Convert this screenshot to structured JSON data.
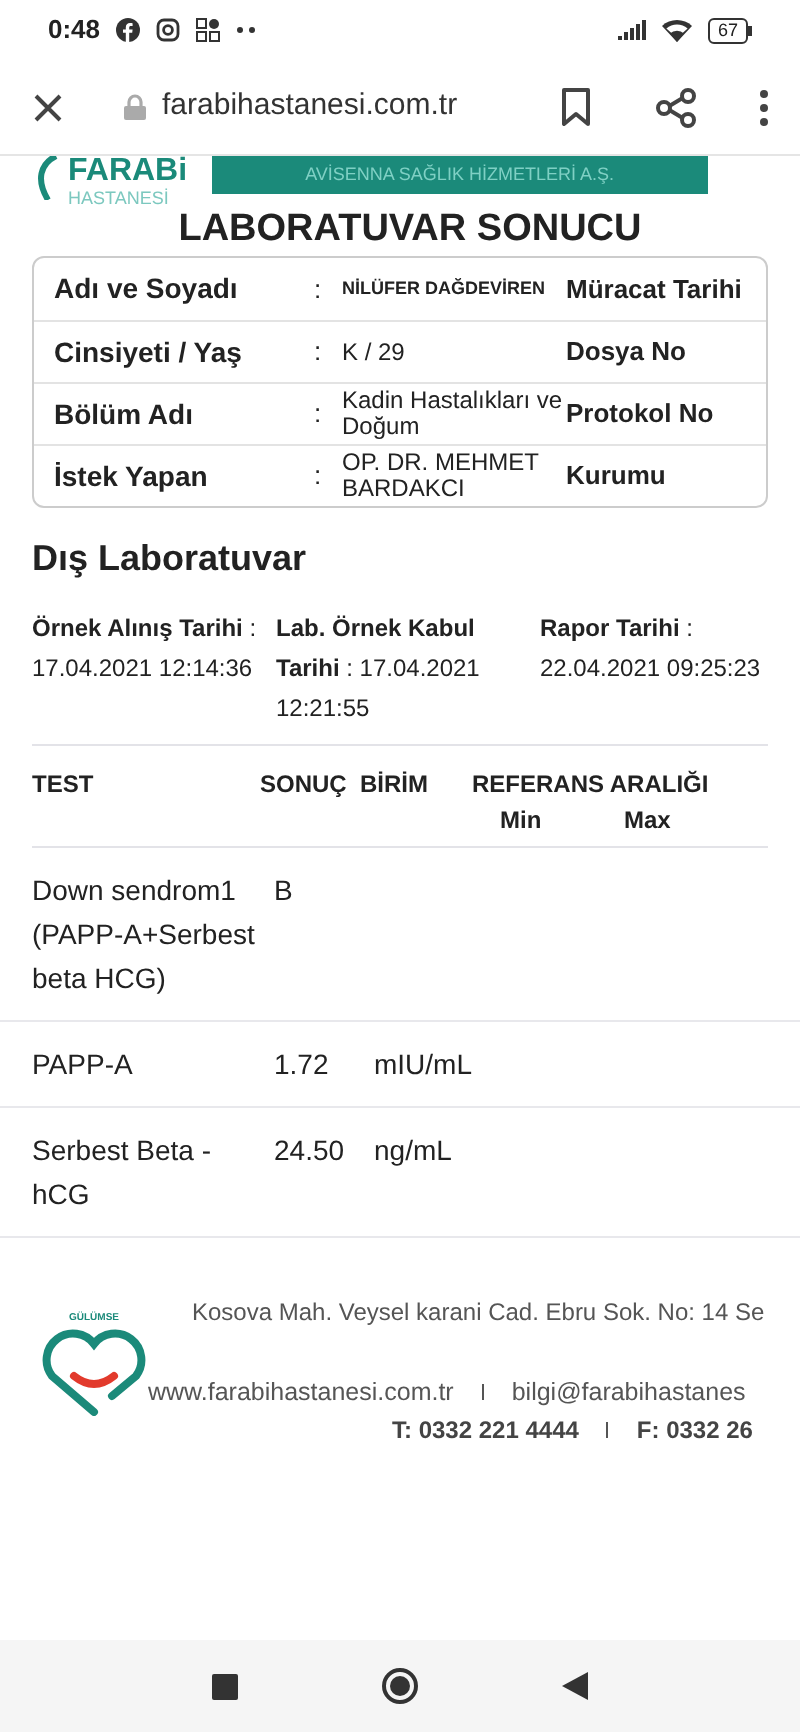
{
  "status_bar": {
    "time": "0:48",
    "battery": "67"
  },
  "browser": {
    "url": "farabihastanesi.com.tr"
  },
  "header": {
    "logo_name": "FARABi",
    "logo_sub": "HASTANESİ",
    "banner_text": "AVİSENNA SAĞLIK HİZMETLERİ A.Ş."
  },
  "title": "LABORATUVAR SONUCU",
  "patient_info": [
    {
      "label": "Adı ve Soyadı",
      "value": "NİLÜFER DAĞDEVİREN",
      "right_label": "Müracat Tarihi",
      "kind": "small",
      "separator": ":"
    },
    {
      "label": "Cinsiyeti / Yaş",
      "value": "K / 29",
      "right_label": "Dosya No",
      "kind": "normal",
      "separator": ":"
    },
    {
      "label": "Bölüm Adı",
      "value": "Kadin Hastalıkları ve Doğum",
      "right_label": "Protokol No",
      "kind": "normal",
      "separator": ":"
    },
    {
      "label": "İstek Yapan",
      "value": "OP. DR. MEHMET BARDAKCI",
      "right_label": "Kurumu",
      "kind": "normal",
      "separator": ":"
    }
  ],
  "section_title": "Dış Laboratuvar",
  "dates": [
    "**Örnek Alınış Tarihi** : 17.04.2021 12:14:36",
    "**Lab. Örnek Kabul Tarihi** : 17.04.2021 12:21:55",
    "**Rapor Tarihi** : 22.04.2021 09:25:23"
  ],
  "table": {
    "columns": [
      "TEST",
      "SONUÇ",
      "BİRİM",
      "REFERANS ARALIĞI"
    ],
    "subcolumns": [
      "Min",
      "Max"
    ],
    "rows": [
      {
        "test": "Down sendrom1 (PAPP-A+Serbest beta HCG)",
        "result": "B"
      },
      {
        "test": "PAPP-A",
        "result": "1.72",
        "unit": "mIU/mL"
      },
      {
        "test": "Serbest Beta - hCG",
        "result": "24.50",
        "unit": "ng/mL"
      }
    ]
  },
  "footer": {
    "logo_text": "GÜLÜMSE",
    "address": "Kosova Mah. Veysel karani Cad. Ebru Sok. No: 14 Se",
    "website": "www.farabihastanesi.com.tr",
    "email": "bilgi@farabihastanes",
    "phone": "T: 0332 221 4444",
    "fax": "F: 0332 26"
  }
}
